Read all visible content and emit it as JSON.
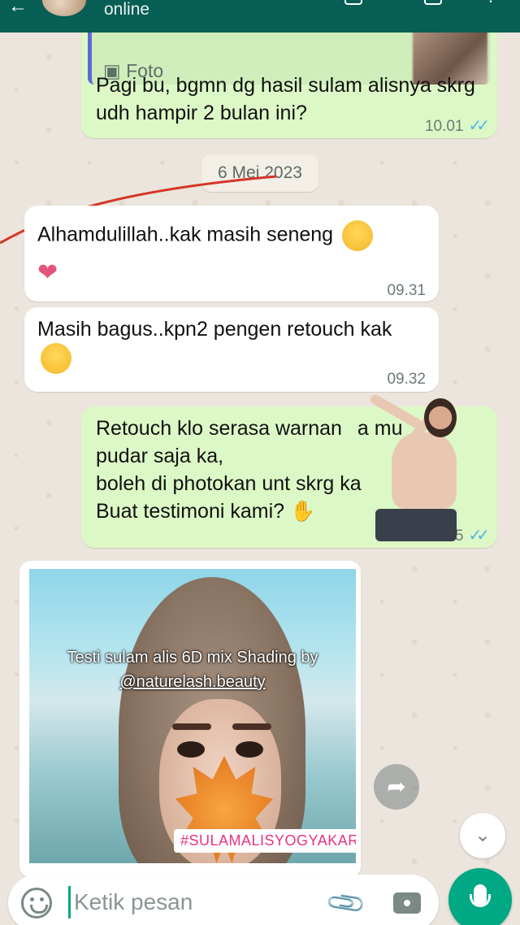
{
  "header": {
    "status": "online"
  },
  "messages": {
    "quoted_label": "Foto",
    "msg1_text": "Pagi bu, bgmn dg hasil sulam alisnya skrg udh hampir 2 bulan ini?",
    "msg1_time": "10.01",
    "date_chip": "6 Mei 2023",
    "msg2_text": "Alhamdulillah..kak masih seneng",
    "msg2_time": "09.31",
    "msg3_text": "Masih bagus..kpn2 pengen retouch kak",
    "msg3_time": "09.32",
    "msg4_line1": "Retouch klo serasa warnan",
    "msg4_line1b": "a mu",
    "msg4_line2": "pudar saja ka,",
    "msg4_line3": "boleh di photokan unt skrg ka",
    "msg4_line4": "Buat testimoni kami?",
    "msg4_time": ".35"
  },
  "photo": {
    "caption_line1": "Testi sulam alis 6D mix Shading by",
    "caption_line2": "@naturelash.beauty",
    "tag": "#SULAMALISYOGYAKARTA"
  },
  "input": {
    "placeholder": "Ketik pesan"
  },
  "colors": {
    "header": "#075e54",
    "outgoing_bubble": "#dcf8c6",
    "incoming_bubble": "#ffffff",
    "read_ticks": "#4fb6ec",
    "mic_button": "#00a884"
  }
}
